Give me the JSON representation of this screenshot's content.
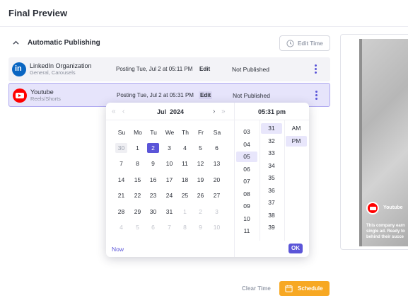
{
  "header": {
    "title": "Final Preview"
  },
  "section": {
    "title": "Automatic Publishing",
    "edit_time_label": "Edit Time"
  },
  "rows": [
    {
      "icon": "linkedin-icon",
      "name": "LinkedIn Organization",
      "sub": "General, Carousels",
      "posting": "Posting Tue, Jul 2 at 05:11 PM",
      "edit": "Edit",
      "status": "Not Published"
    },
    {
      "icon": "youtube-icon",
      "name": "Youtube",
      "sub": "Reels/Shorts",
      "posting": "Posting Tue, Jul 2 at 05:31 PM",
      "edit": "Edit",
      "status": "Not Published"
    }
  ],
  "calendar": {
    "month": "Jul",
    "year": "2024",
    "weekdays": [
      "Su",
      "Mo",
      "Tu",
      "We",
      "Th",
      "Fr",
      "Sa"
    ],
    "weeks": [
      [
        "30",
        "1",
        "2",
        "3",
        "4",
        "5",
        "6"
      ],
      [
        "7",
        "8",
        "9",
        "10",
        "11",
        "12",
        "13"
      ],
      [
        "14",
        "15",
        "16",
        "17",
        "18",
        "19",
        "20"
      ],
      [
        "21",
        "22",
        "23",
        "24",
        "25",
        "26",
        "27"
      ],
      [
        "28",
        "29",
        "30",
        "31",
        "1",
        "2",
        "3"
      ],
      [
        "4",
        "5",
        "6",
        "7",
        "8",
        "9",
        "10"
      ]
    ],
    "selected": "2",
    "now_label": "Now"
  },
  "time": {
    "display": "05:31 pm",
    "hours": [
      "03",
      "04",
      "05",
      "06",
      "07",
      "08",
      "09",
      "10",
      "11"
    ],
    "selected_hour": "05",
    "minutes": [
      "31",
      "32",
      "33",
      "34",
      "35",
      "36",
      "37",
      "38",
      "39"
    ],
    "selected_minute": "31",
    "periods": [
      "AM",
      "PM"
    ],
    "selected_period": "PM",
    "ok_label": "OK"
  },
  "footer": {
    "clear_label": "Clear Time",
    "schedule_label": "Schedule"
  },
  "preview": {
    "channel": "Youtube",
    "caption": [
      "This company earn",
      "single ad. Ready to",
      "behind their succe"
    ]
  },
  "colors": {
    "accent": "#5b55d8",
    "schedule": "#f7a823",
    "linkedin": "#0a66c2",
    "youtube": "#ff0000"
  }
}
